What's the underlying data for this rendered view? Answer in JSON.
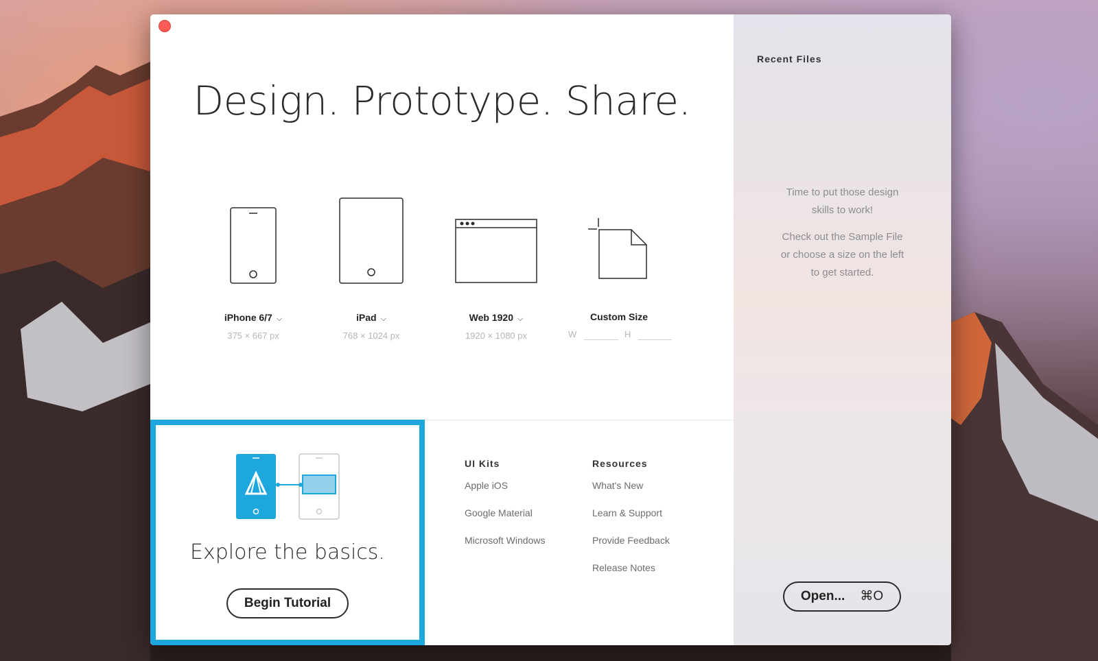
{
  "window": {
    "close_icon": "close-icon"
  },
  "main": {
    "headline": "Design. Prototype. Share.",
    "presets": [
      {
        "label": "iPhone 6/7",
        "size": "375 × 667 px",
        "icon": "phone-icon",
        "has_dropdown": true
      },
      {
        "label": "iPad",
        "size": "768 × 1024 px",
        "icon": "tablet-icon",
        "has_dropdown": true
      },
      {
        "label": "Web 1920",
        "size": "1920 × 1080 px",
        "icon": "browser-window-icon",
        "has_dropdown": true
      },
      {
        "label": "Custom Size",
        "icon": "custom-document-icon",
        "w_label": "W",
        "h_label": "H",
        "w_value": "",
        "h_value": ""
      }
    ],
    "chevron": "⌄"
  },
  "tutorial": {
    "title": "Explore the basics.",
    "button_label": "Begin Tutorial",
    "illustration_icon": "tutorial-devices-icon",
    "accent": "#1ea7dc"
  },
  "ui_kits": {
    "title": "UI Kits",
    "items": [
      "Apple iOS",
      "Google Material",
      "Microsoft Windows"
    ]
  },
  "resources": {
    "title": "Resources",
    "items": [
      "What's New",
      "Learn & Support",
      "Provide Feedback",
      "Release Notes"
    ]
  },
  "side": {
    "recent_title": "Recent Files",
    "message_1": "Time to put those design skills to work!",
    "message_2": "Check out the Sample File or choose a size on the left to get started.",
    "open_label": "Open...",
    "open_shortcut": "⌘O"
  }
}
